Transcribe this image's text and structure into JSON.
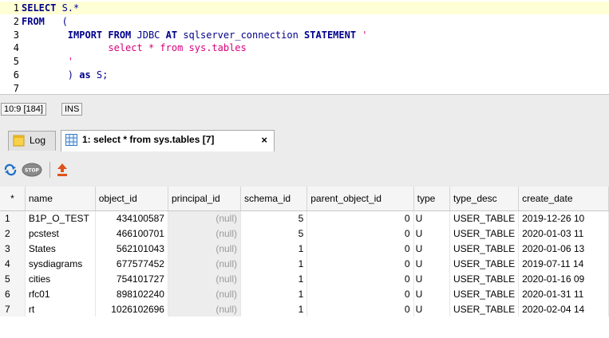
{
  "editor": {
    "lines": [
      {
        "num": "1",
        "parts": [
          {
            "t": "SELECT",
            "c": "kw"
          },
          {
            "t": " S.*",
            "c": "pl"
          }
        ]
      },
      {
        "num": "2",
        "parts": [
          {
            "t": "FROM",
            "c": "kw"
          },
          {
            "t": "   (",
            "c": "pl"
          }
        ]
      },
      {
        "num": "3",
        "parts": [
          {
            "t": "        ",
            "c": "pl"
          },
          {
            "t": "IMPORT FROM",
            "c": "kw"
          },
          {
            "t": " JDBC ",
            "c": "pl"
          },
          {
            "t": "AT",
            "c": "kw"
          },
          {
            "t": " sqlserver_connection ",
            "c": "pl"
          },
          {
            "t": "STATEMENT",
            "c": "kw"
          },
          {
            "t": " '",
            "c": "str"
          }
        ]
      },
      {
        "num": "4",
        "parts": [
          {
            "t": "               select * from sys.tables",
            "c": "str"
          }
        ]
      },
      {
        "num": "5",
        "parts": [
          {
            "t": "        '",
            "c": "str"
          }
        ]
      },
      {
        "num": "6",
        "parts": [
          {
            "t": "        ) ",
            "c": "pl"
          },
          {
            "t": "as",
            "c": "kw"
          },
          {
            "t": " S;",
            "c": "pl"
          }
        ]
      },
      {
        "num": "7",
        "parts": []
      }
    ]
  },
  "status": {
    "position": "10:9 [184]",
    "mode": "INS"
  },
  "tabs": {
    "log_label": "Log",
    "result_label": "1: select * from sys.tables [7]",
    "close_glyph": "×"
  },
  "grid": {
    "columns": [
      "*",
      "name",
      "object_id",
      "principal_id",
      "schema_id",
      "parent_object_id",
      "type",
      "type_desc",
      "create_date"
    ],
    "rows": [
      [
        "1",
        "B1P_O_TEST",
        "434100587",
        "(null)",
        "5",
        "0",
        "U",
        "USER_TABLE",
        "2019-12-26 10"
      ],
      [
        "2",
        "pcstest",
        "466100701",
        "(null)",
        "5",
        "0",
        "U",
        "USER_TABLE",
        "2020-01-03 11"
      ],
      [
        "3",
        "States",
        "562101043",
        "(null)",
        "1",
        "0",
        "U",
        "USER_TABLE",
        "2020-01-06 13"
      ],
      [
        "4",
        "sysdiagrams",
        "677577452",
        "(null)",
        "1",
        "0",
        "U",
        "USER_TABLE",
        "2019-07-11 14"
      ],
      [
        "5",
        "cities",
        "754101727",
        "(null)",
        "1",
        "0",
        "U",
        "USER_TABLE",
        "2020-01-16 09"
      ],
      [
        "6",
        "rfc01",
        "898102240",
        "(null)",
        "1",
        "0",
        "U",
        "USER_TABLE",
        "2020-01-31 11"
      ],
      [
        "7",
        "rt",
        "1026102696",
        "(null)",
        "1",
        "0",
        "U",
        "USER_TABLE",
        "2020-02-04 14"
      ]
    ]
  },
  "icons": {
    "log_tab": "log-icon",
    "result_tab": "grid-icon",
    "refresh": "refresh-icon",
    "stop": "stop-icon",
    "export": "export-icon"
  },
  "colors": {
    "current_line": "#ffffd6",
    "keyword": "#00008b",
    "string": "#d8007a",
    "null_text": "#9a9a9a"
  }
}
